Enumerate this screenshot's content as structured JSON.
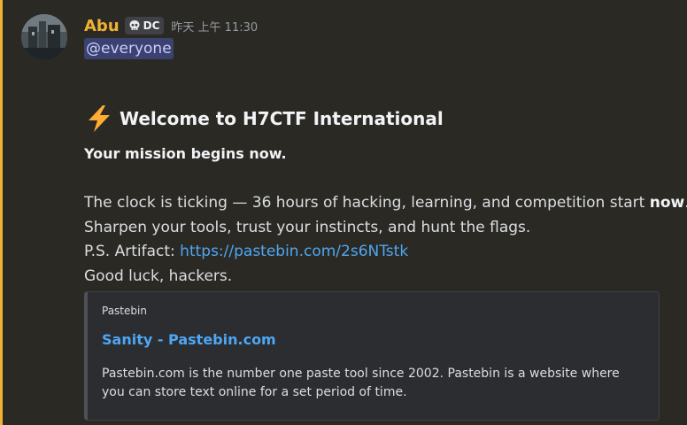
{
  "message": {
    "username": "Abu",
    "badge": "DC",
    "badge_icon": "skull-icon",
    "timestamp": "昨天 上午 11:30",
    "mention": "@everyone",
    "heading": {
      "emoji": "lightning-icon",
      "text": "Welcome to H7CTF International"
    },
    "mission_line": "Your mission begins now.",
    "clock_line": {
      "prefix": "The clock is ticking — 36 hours of hacking, learning, and competition start ",
      "emphasis": "now",
      "suffix": "."
    },
    "tools_line": "Sharpen your tools, trust your instincts, and hunt the flags.",
    "artifact_line": {
      "prefix": "P.S. Artifact: ",
      "link": "https://pastebin.com/2s6NTstk"
    },
    "luck_line": "Good luck, hackers.",
    "embed": {
      "provider": "Pastebin",
      "title": "Sanity - Pastebin.com",
      "description": "Pastebin.com is the number one paste tool since 2002. Pastebin is a website where you can store text online for a set period of time."
    }
  },
  "colors": {
    "username": "#f0b232",
    "mention_bar": "#f0b232",
    "link": "#4ea7f3",
    "mention_text": "#c9cdfb",
    "mention_bg": "#3c4270",
    "background": "#2b2924"
  }
}
